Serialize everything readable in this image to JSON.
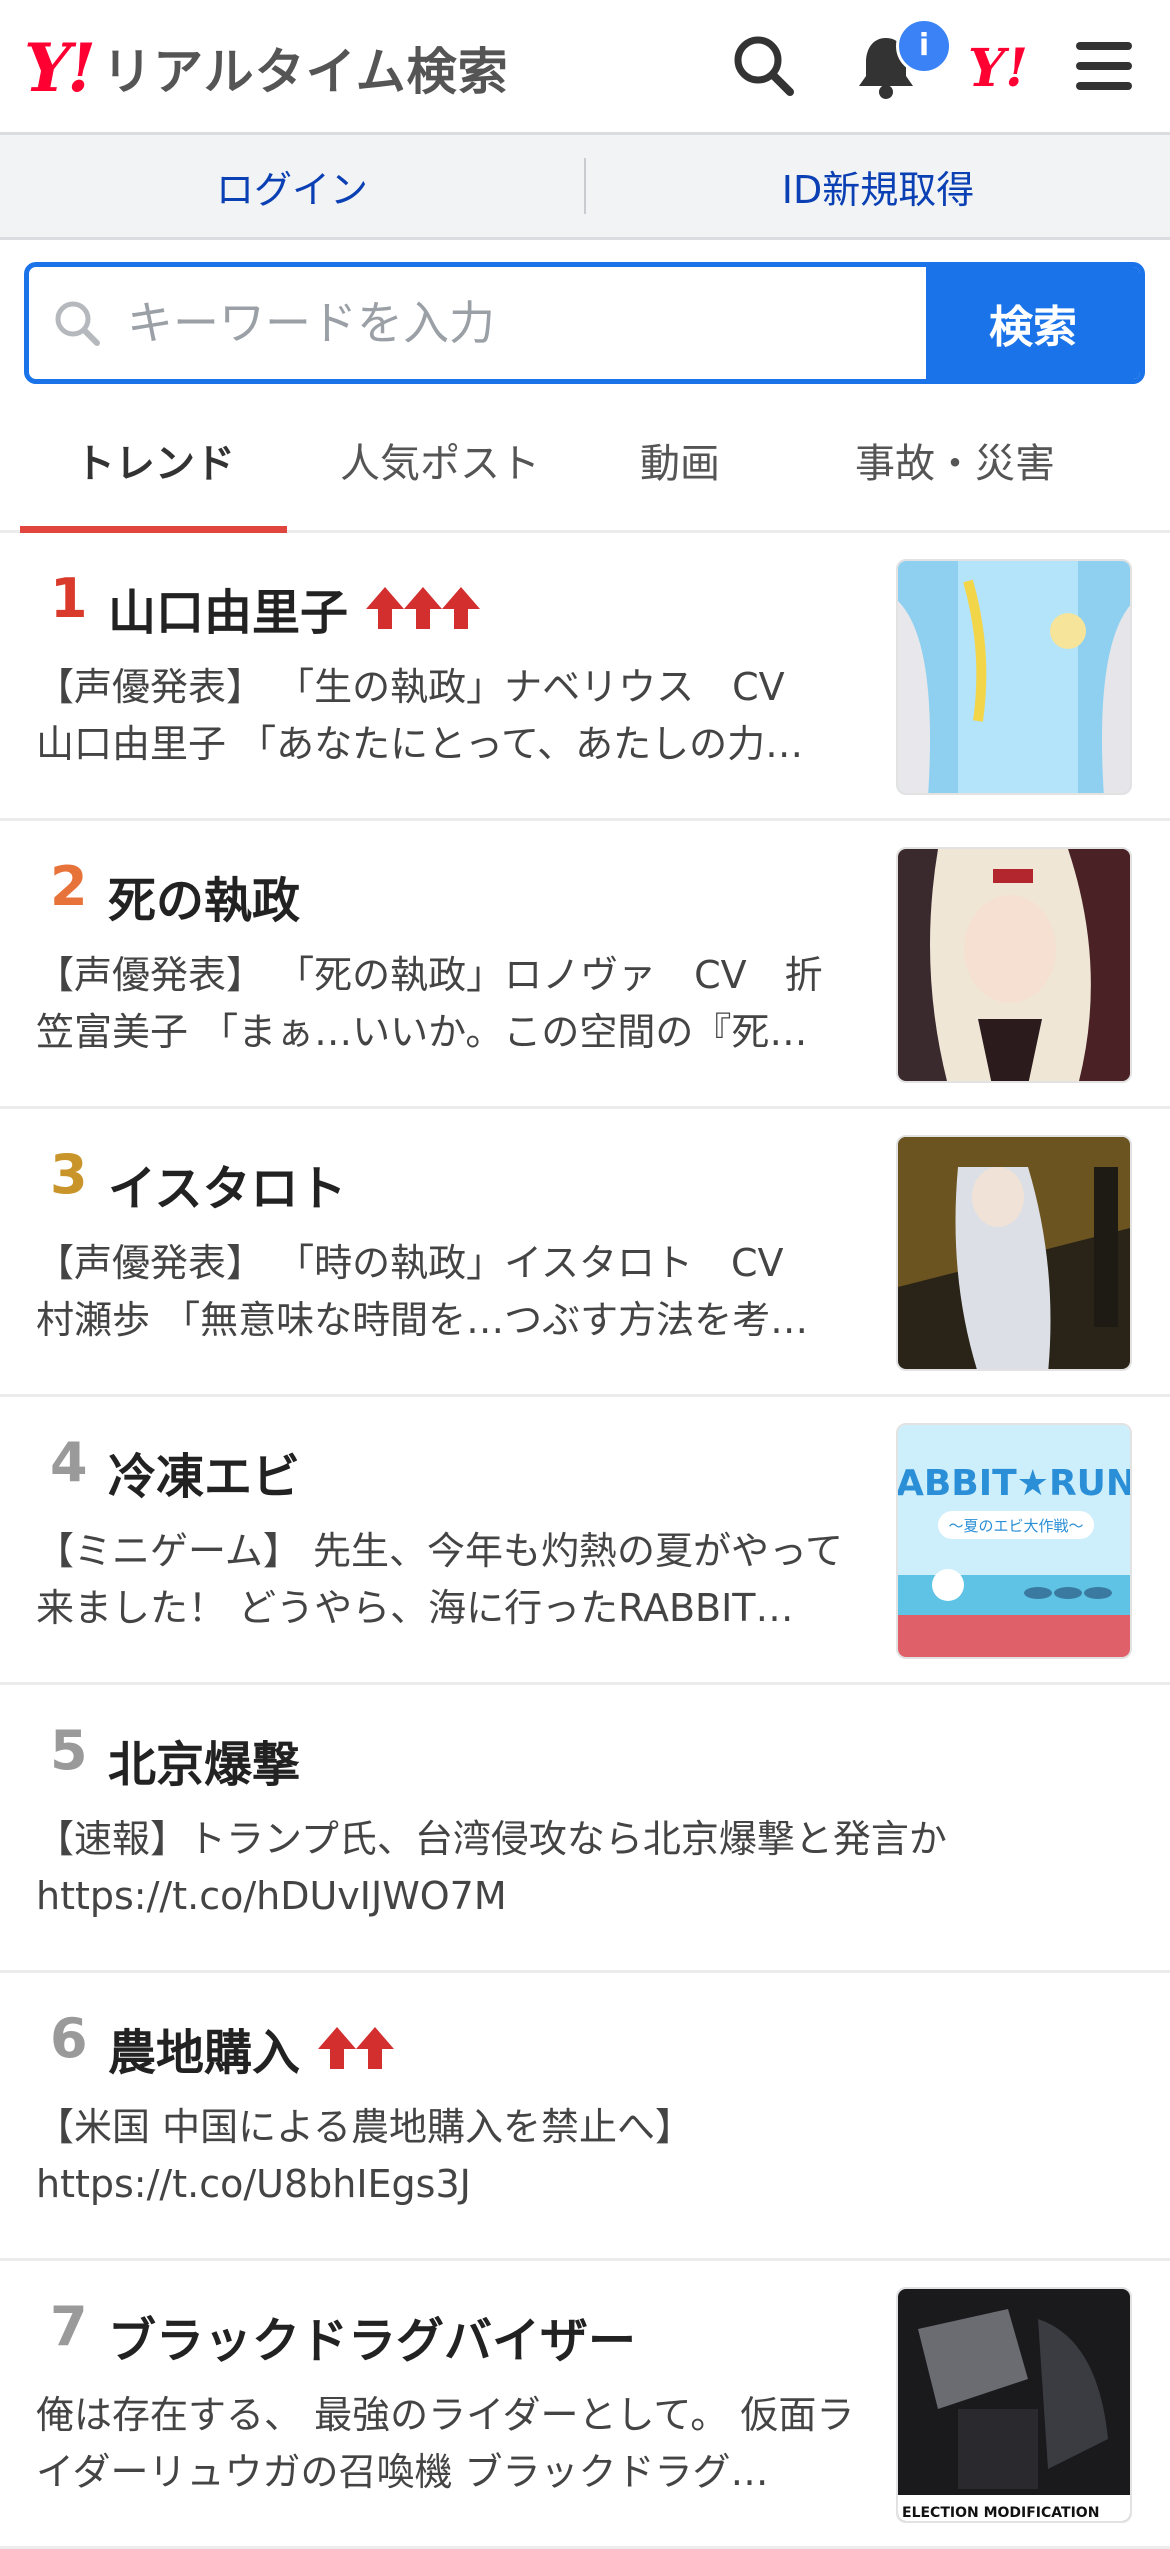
{
  "header": {
    "logo_y": "Y!",
    "logo_text": "リアルタイム検索",
    "badge": "i",
    "yahoo_mark": "Y!"
  },
  "login": {
    "login_label": "ログイン",
    "register_label": "ID新規取得"
  },
  "search": {
    "placeholder": "キーワードを入力",
    "button_label": "検索"
  },
  "tabs": [
    {
      "label": "トレンド",
      "active": true
    },
    {
      "label": "人気ポスト",
      "active": false
    },
    {
      "label": "動画",
      "active": false
    },
    {
      "label": "事故・災害",
      "active": false
    }
  ],
  "trends": [
    {
      "rank": "1",
      "title": "山口由里子",
      "arrows": 3,
      "rank_color": "#d93a2b",
      "desc": "【声優発表】 「生の執政」ナベリウス　CV　山口由里子 「あなたにとって、あたしの力…",
      "thumb": "ice-blue-character"
    },
    {
      "rank": "2",
      "title": "死の執政",
      "arrows": 0,
      "rank_color": "#e8733a",
      "desc": "【声優発表】 「死の執政」ロノヴァ　CV　折笠富美子 「まぁ…いいか。この空間の『死…",
      "thumb": "dark-red-character"
    },
    {
      "rank": "3",
      "title": "イスタロト",
      "arrows": 0,
      "rank_color": "#c9952a",
      "desc": "【声優発表】 「時の執政」イスタロト　CV　村瀬歩 「無意味な時間を…つぶす方法を考…",
      "thumb": "golden-character"
    },
    {
      "rank": "4",
      "title": "冷凍エビ",
      "arrows": 0,
      "rank_color": "#9a9a9a",
      "desc": "【ミニゲーム】 先生、今年も灼熱の夏がやって来ました！ どうやら、海に行ったRABBIT…",
      "thumb": "rabbit-run-banner"
    },
    {
      "rank": "5",
      "title": "北京爆撃",
      "arrows": 0,
      "rank_color": "#9a9a9a",
      "desc": "【速報】トランプ氏、台湾侵攻なら北京爆撃と発言か https://t.co/hDUvIJWO7M",
      "thumb": ""
    },
    {
      "rank": "6",
      "title": "農地購入",
      "arrows": 2,
      "rank_color": "#9a9a9a",
      "desc": "【米国 中国による農地購入を禁止へ】 https://t.co/U8bhIEgs3J",
      "thumb": ""
    },
    {
      "rank": "7",
      "title": "ブラックドラグバイザー",
      "arrows": 0,
      "rank_color": "#9a9a9a",
      "desc": "俺は存在する、 最強のライダーとして。 仮面ライダーリュウガの召喚機 ブラックドラグ…",
      "thumb": "rider-figure"
    }
  ],
  "thumb_texts": {
    "rabbit_title": "ABBIT★RUN",
    "rabbit_sub": "〜夏のエビ大作戦〜",
    "rider_caption": "ELECTION MODIFICATION"
  },
  "colors": {
    "accent_blue": "#1a73e8",
    "tab_underline": "#e0463d",
    "arrow_red": "#d32f2f"
  }
}
